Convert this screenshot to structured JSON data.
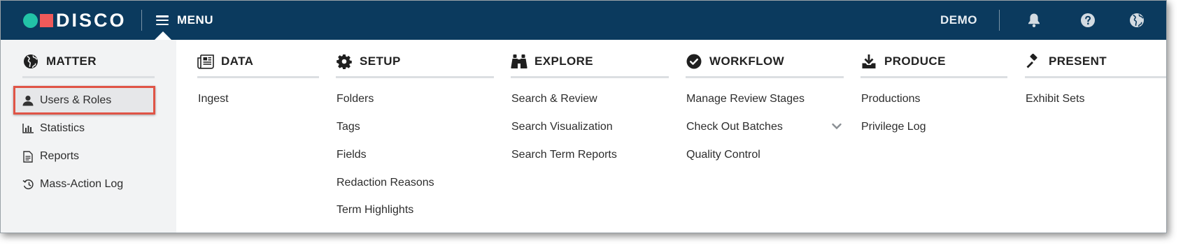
{
  "app": {
    "logo_text": "DISCO",
    "menu_label": "MENU",
    "environment": "DEMO",
    "colors": {
      "topbar": "#0b3a5e",
      "logo_dot": "#22c3a7",
      "logo_square": "#ef5a5a",
      "highlight_border": "#e05446"
    },
    "icons": [
      "bell-icon",
      "help-icon",
      "globe-icon",
      "hamburger-icon"
    ]
  },
  "menu": {
    "matter": {
      "heading": "MATTER",
      "icon": "globe-icon",
      "items": [
        {
          "label": "Users & Roles",
          "icon": "user-icon",
          "selected": true
        },
        {
          "label": "Statistics",
          "icon": "bar-chart-icon"
        },
        {
          "label": "Reports",
          "icon": "document-icon"
        },
        {
          "label": "Mass-Action Log",
          "icon": "history-icon"
        }
      ]
    },
    "data": {
      "heading": "DATA",
      "icon": "newspaper-icon",
      "items": [
        "Ingest"
      ]
    },
    "setup": {
      "heading": "SETUP",
      "icon": "gear-icon",
      "items": [
        "Folders",
        "Tags",
        "Fields",
        "Redaction Reasons",
        "Term Highlights"
      ]
    },
    "explore": {
      "heading": "EXPLORE",
      "icon": "binoculars-icon",
      "items": [
        "Search & Review",
        "Search Visualization",
        "Search Term Reports"
      ]
    },
    "workflow": {
      "heading": "WORKFLOW",
      "icon": "check-circle-icon",
      "items": [
        "Manage Review Stages",
        "Check Out Batches",
        "Quality Control"
      ]
    },
    "produce": {
      "heading": "PRODUCE",
      "icon": "download-tray-icon",
      "items": [
        "Productions",
        "Privilege Log"
      ]
    },
    "present": {
      "heading": "PRESENT",
      "icon": "gavel-icon",
      "items": [
        "Exhibit Sets"
      ]
    }
  }
}
